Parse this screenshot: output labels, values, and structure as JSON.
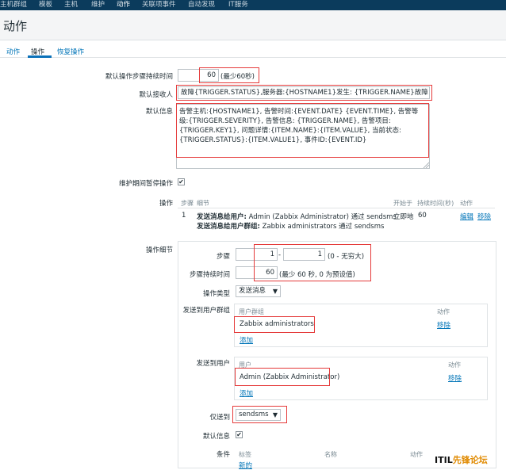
{
  "nav": {
    "items": [
      "主机群组",
      "模板",
      "主机",
      "维护",
      "动作",
      "关联项事件",
      "自动发现",
      "IT服务"
    ],
    "active_index": 4
  },
  "page": {
    "title": "动作"
  },
  "tabs": [
    "动作",
    "操作",
    "恢复操作"
  ],
  "form": {
    "default_step_duration_label": "默认操作步骤持续时间",
    "default_step_duration_value": "60",
    "default_step_duration_hint": "(最少60秒)",
    "default_subject_label": "默认接收人",
    "default_subject_value": "故障{TRIGGER.STATUS},服务器:{HOSTNAME1}发生: {TRIGGER.NAME}故障!",
    "default_message_label": "默认信息",
    "default_message_value": "告警主机:{HOSTNAME1}, 告警时间:{EVENT.DATE} {EVENT.TIME}, 告警等级:{TRIGGER.SEVERITY}, 告警信息: {TRIGGER.NAME}, 告警项目:{TRIGGER.KEY1}, 问题详情:{ITEM.NAME}:{ITEM.VALUE}, 当前状态:{TRIGGER.STATUS}:{ITEM.VALUE1}, 事件ID:{EVENT.ID}",
    "pause_maintenance_label": "维护期间暂停操作",
    "pause_maintenance_checked": true,
    "operations_label": "操作",
    "operations_headers": {
      "steps": "步骤",
      "details": "细节",
      "start_in": "开始于",
      "duration": "持续时间(秒)",
      "action": "动作"
    },
    "operations_rows": [
      {
        "step": "1",
        "detail_line1_bold": "发送消息给用户:",
        "detail_line1_rest": " Admin (Zabbix Administrator) 通过 sendsms",
        "detail_line2_bold": "发送消息给用户群组:",
        "detail_line2_rest": " Zabbix administrators 通过 sendsms",
        "start_in": "立即地",
        "duration": "60",
        "edit": "编辑",
        "remove": "移除"
      }
    ],
    "operation_details_label": "操作细节",
    "steps_label": "步骤",
    "steps_from": "1",
    "steps_separator": "-",
    "steps_to": "1",
    "steps_hint": "(0 - 无穷大)",
    "step_duration_label": "步骤持续时间",
    "step_duration_value": "60",
    "step_duration_hint": "(最少 60 秒, 0 为预设值)",
    "operation_type_label": "操作类型",
    "operation_type_value": "发送消息",
    "send_to_groups_label": "发送到用户群组",
    "groups_header_name": "用户群组",
    "groups_header_action": "动作",
    "groups_rows": [
      {
        "name": "Zabbix administrators",
        "remove": "移除"
      }
    ],
    "groups_add": "添加",
    "send_to_users_label": "发送到用户",
    "users_header_name": "用户",
    "users_header_action": "动作",
    "users_rows": [
      {
        "name": "Admin (Zabbix Administrator)",
        "remove": "移除"
      }
    ],
    "users_add": "添加",
    "send_only_to_label": "仅送到",
    "send_only_to_value": "sendsms",
    "default_message_check_label": "默认信息",
    "default_message_check_checked": true,
    "conditions_label": "条件",
    "conditions_headers": {
      "label": "标签",
      "name": "名称",
      "action": "动作"
    },
    "conditions_new": "新的"
  },
  "watermark": {
    "latin": "ITIL",
    "cn": "先锋论坛"
  },
  "colors": {
    "nav_bg": "#0b3b5c",
    "link": "#0275b8",
    "highlight_box": "#e53a3a"
  }
}
